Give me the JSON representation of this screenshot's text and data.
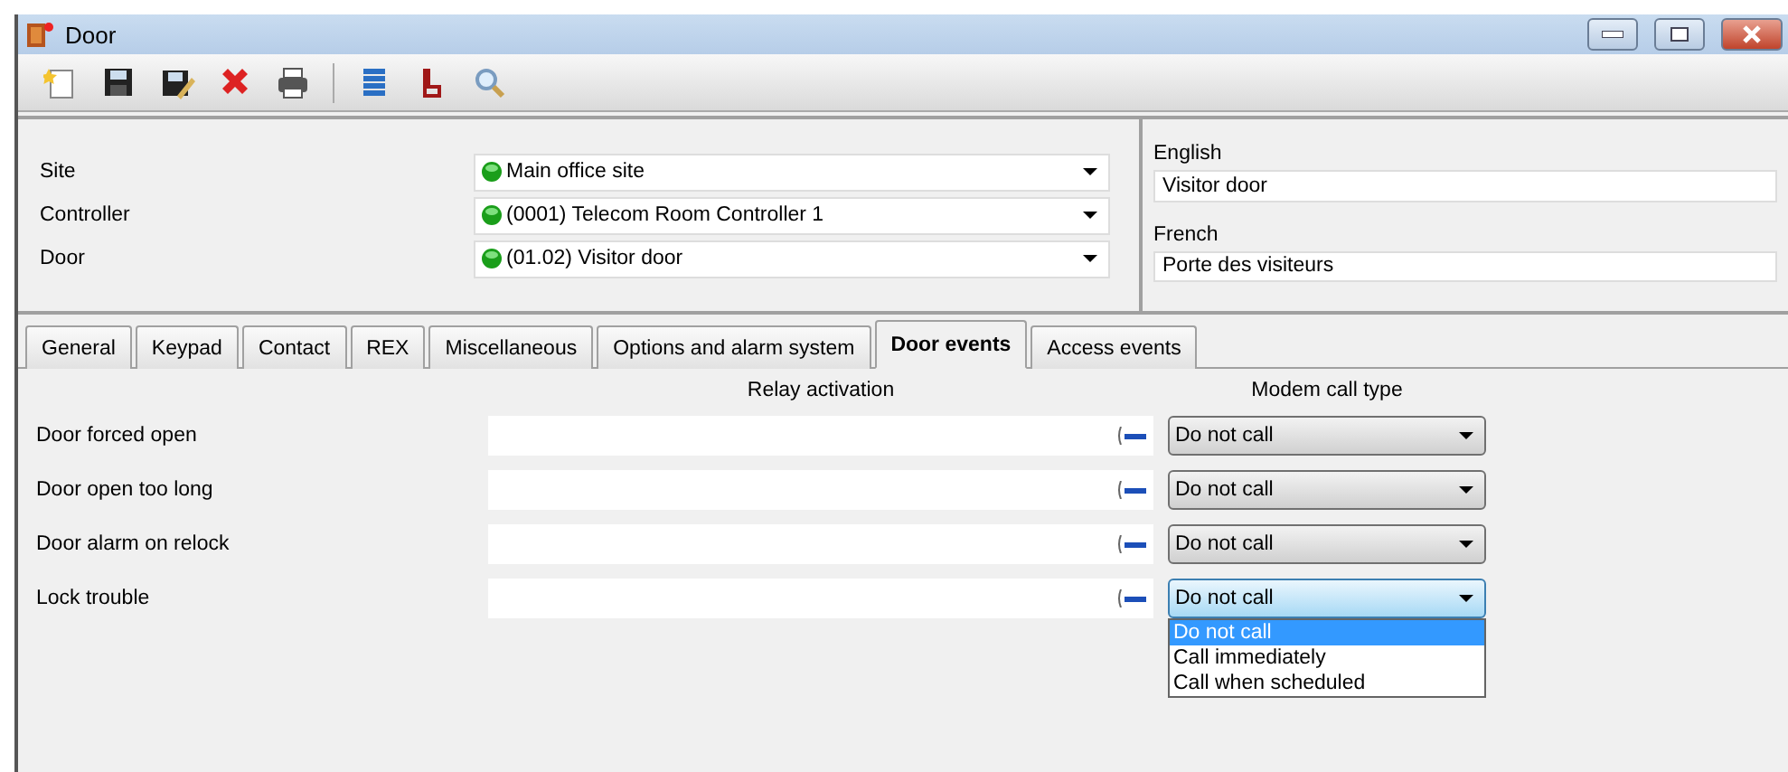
{
  "window": {
    "title": "Door"
  },
  "selectors": [
    {
      "label": "Site",
      "value": "Main office site"
    },
    {
      "label": "Controller",
      "value": "(0001) Telecom Room Controller 1"
    },
    {
      "label": "Door",
      "value": "(01.02) Visitor door"
    }
  ],
  "translations": [
    {
      "language": "English",
      "value": "Visitor door"
    },
    {
      "language": "French",
      "value": "Porte des visiteurs"
    }
  ],
  "tabs": [
    {
      "label": "General",
      "selected": false
    },
    {
      "label": "Keypad",
      "selected": false
    },
    {
      "label": "Contact",
      "selected": false
    },
    {
      "label": "REX",
      "selected": false
    },
    {
      "label": "Miscellaneous",
      "selected": false
    },
    {
      "label": "Options and alarm system",
      "selected": false
    },
    {
      "label": "Door events",
      "selected": true
    },
    {
      "label": "Access events",
      "selected": false
    }
  ],
  "door_events": {
    "columns": [
      "Relay activation",
      "Modem call type"
    ],
    "rows": [
      {
        "label": "Door forced open",
        "call_type": "Do not call",
        "expanded": false
      },
      {
        "label": "Door open too long",
        "call_type": "Do not call",
        "expanded": false
      },
      {
        "label": "Door alarm on relock",
        "call_type": "Do not call",
        "expanded": false
      },
      {
        "label": "Lock trouble",
        "call_type": "Do not call",
        "expanded": true,
        "options": [
          {
            "label": "Do not call",
            "selected": true
          },
          {
            "label": "Call immediately",
            "selected": false
          },
          {
            "label": "Call when scheduled",
            "selected": false
          }
        ]
      }
    ]
  }
}
